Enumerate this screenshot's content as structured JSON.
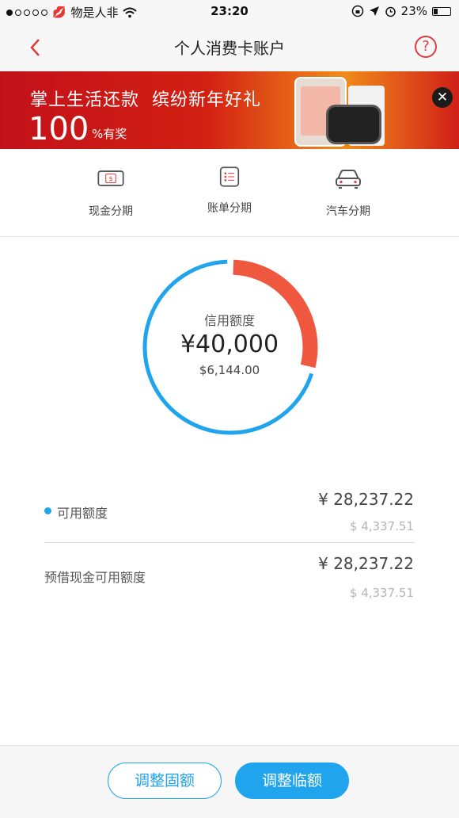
{
  "status_bar": {
    "carrier": "物是人非",
    "time": "23:20",
    "battery": "23%"
  },
  "nav": {
    "title": "个人消费卡账户",
    "back_icon": "chevron-left-icon",
    "help_label": "?"
  },
  "banner": {
    "headline": "掌上生活还款  缤纷新年好礼",
    "big_number": "100",
    "suffix": "%有奖",
    "close_label": "✕"
  },
  "quick_actions": [
    {
      "label": "现金分期",
      "icon": "cash-icon"
    },
    {
      "label": "账单分期",
      "icon": "bill-icon"
    },
    {
      "label": "汽车分期",
      "icon": "car-icon"
    }
  ],
  "credit": {
    "label": "信用额度",
    "amount_cny": "¥40,000",
    "amount_usd": "$6,144.00",
    "available_fraction": 0.706,
    "colors": {
      "available": "#20a4ee",
      "used": "#f0573f"
    }
  },
  "rows": [
    {
      "label": "可用额度",
      "cny": "¥ 28,237.22",
      "usd": "$ 4,337.51"
    },
    {
      "label": "预借现金可用额度",
      "cny": "¥ 28,237.22",
      "usd": "$ 4,337.51"
    }
  ],
  "buttons": {
    "fixed": "调整固额",
    "temp": "调整临额"
  }
}
